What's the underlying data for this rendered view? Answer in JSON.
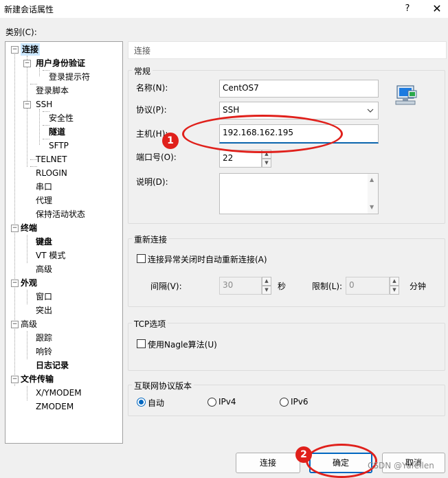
{
  "window": {
    "title": "新建会话属性",
    "help": "?",
    "close": "✕"
  },
  "category_label": "类别(C):",
  "tree": {
    "connection": "连接",
    "auth": "用户身份验证",
    "login_prompt": "登录提示符",
    "login_script": "登录脚本",
    "ssh": "SSH",
    "security": "安全性",
    "tunnel": "隧道",
    "sftp": "SFTP",
    "telnet": "TELNET",
    "rlogin": "RLOGIN",
    "serial": "串口",
    "proxy": "代理",
    "keepalive": "保持活动状态",
    "terminal": "终端",
    "keyboard": "键盘",
    "vt_mode": "VT 模式",
    "advanced_term": "高级",
    "appearance": "外观",
    "window": "窗口",
    "highlight": "突出",
    "advanced": "高级",
    "trace": "跟踪",
    "bell": "响铃",
    "logging": "日志记录",
    "file_transfer": "文件传输",
    "xymodem": "X/YMODEM",
    "zmodem": "ZMODEM"
  },
  "panel": {
    "header": "连接",
    "general": {
      "title": "常规",
      "name_label": "名称(N):",
      "name_value": "CentOS7",
      "protocol_label": "协议(P):",
      "protocol_value": "SSH",
      "host_label": "主机(H):",
      "host_value": "192.168.162.195",
      "port_label": "端口号(O):",
      "port_value": "22",
      "desc_label": "说明(D):",
      "desc_value": ""
    },
    "reconnect": {
      "title": "重新连接",
      "checkbox_label": "连接异常关闭时自动重新连接(A)",
      "interval_label": "间隔(V):",
      "interval_value": "30",
      "interval_unit": "秒",
      "limit_label": "限制(L):",
      "limit_value": "0",
      "limit_unit": "分钟"
    },
    "tcp": {
      "title": "TCP选项",
      "nagle_label": "使用Nagle算法(U)"
    },
    "ip_version": {
      "title": "互联网协议版本",
      "options": [
        "自动",
        "IPv4",
        "IPv6"
      ],
      "selected": "自动"
    }
  },
  "buttons": {
    "connect": "连接",
    "ok": "确定",
    "cancel": "取消"
  },
  "annotations": {
    "marker1": "1",
    "marker2": "2",
    "accent": "#e0201b"
  },
  "watermark": "CSDN @Yufeilen",
  "icons": {
    "computer": "network-computer-icon",
    "dropdown": "chevron-down-icon"
  }
}
